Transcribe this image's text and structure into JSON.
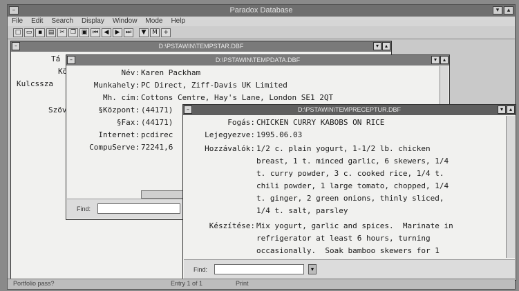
{
  "app": {
    "title": "Paradox Database",
    "menus": [
      "File",
      "Edit",
      "Search",
      "Display",
      "Window",
      "Mode",
      "Help"
    ]
  },
  "status": {
    "left": "Portfolio pass?",
    "middle": "Entry 1 of 1",
    "right": "Print"
  },
  "win1": {
    "title": "D:\\PSTAWIN\\TEMPSTAR.DBF",
    "labels": [
      "Tá",
      "Kö",
      "Kulcssza",
      "Szöv"
    ]
  },
  "win2": {
    "title": "D:\\PSTAWIN\\TEMPDATA.DBF",
    "fields": [
      {
        "label": "Név:",
        "value": "Karen Packham"
      },
      {
        "label": "Munkahely:",
        "value": "PC Direct, Ziff-Davis UK Limited"
      },
      {
        "label": "Mh. cím:",
        "value": "Cottons Centre, Hay's Lane, London SE1 2QT"
      },
      {
        "label": "§Központ:",
        "value": "(44171)"
      },
      {
        "label": "§Fax:",
        "value": "(44171)"
      },
      {
        "label": "Internet:",
        "value": "pcdirec"
      },
      {
        "label": "CompuServe:",
        "value": "72241,6"
      }
    ],
    "find_label": "Find:"
  },
  "win3": {
    "title": "D:\\PSTAWIN\\TEMPRECEPTUR.DBF",
    "fields": [
      {
        "label": "Fogás:",
        "lines": [
          "CHICKEN CURRY KABOBS ON RICE"
        ]
      },
      {
        "label": "Lejegyezve:",
        "lines": [
          "1995.06.03"
        ]
      },
      {
        "label": "Hozzávalók:",
        "lines": [
          "1/2 c. plain yogurt, 1-1/2 lb. chicken",
          "breast, 1 t. minced garlic, 6 skewers, 1/4",
          "t. curry powder, 3 c. cooked rice, 1/4 t.",
          "chili powder, 1 large tomato, chopped, 1/4",
          "t. ginger, 2 green onions, thinly sliced,",
          "1/4 t. salt, parsley"
        ]
      },
      {
        "label": "Készítése:",
        "lines": [
          "Mix yogurt, garlic and spices.  Marinate in",
          "refrigerator at least 6 hours, turning",
          "occasionally.  Soak bamboo skewers for 1"
        ]
      }
    ],
    "find_label": "Find:"
  }
}
